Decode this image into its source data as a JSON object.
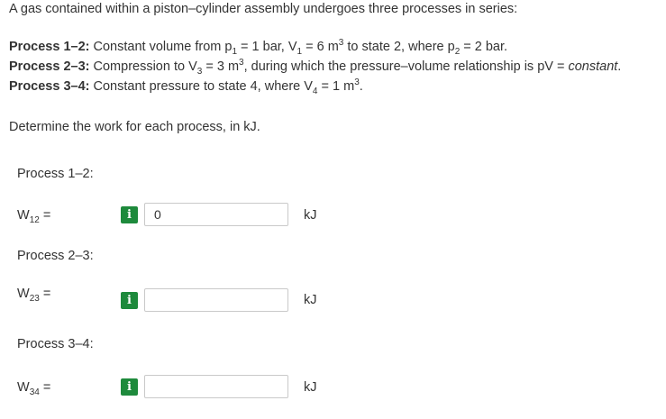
{
  "problem": {
    "intro": "A gas contained within a piston–cylinder assembly undergoes three processes in series:",
    "p12": {
      "label": "Process 1–2:",
      "text_a": " Constant volume from p",
      "sub_1": "1",
      "text_b": " = 1 bar, V",
      "sub_2": "1",
      "text_c": " = 6 m",
      "sup_1": "3",
      "text_d": " to state 2, where p",
      "sub_3": "2",
      "text_e": " = 2 bar."
    },
    "p23": {
      "label": "Process 2–3:",
      "text_a": " Compression to V",
      "sub_1": "3",
      "text_b": " = 3 m",
      "sup_1": "3",
      "text_c": ", during which the pressure–volume relationship is pV = ",
      "italic": "constant",
      "text_d": "."
    },
    "p34": {
      "label": "Process 3–4:",
      "text_a": " Constant pressure to state 4, where V",
      "sub_1": "4",
      "text_b": " = 1 m",
      "sup_1": "3",
      "text_c": "."
    },
    "question": "Determine the work for each process, in kJ."
  },
  "answers": [
    {
      "section_title": "Process 1–2:",
      "var_main": "W",
      "var_sub": "12",
      "equals": " =",
      "info_glyph": "i",
      "value": "0",
      "unit": "kJ"
    },
    {
      "section_title": "Process 2–3:",
      "var_main": "W",
      "var_sub": "23",
      "equals": " =",
      "info_glyph": "i",
      "value": "",
      "unit": "kJ"
    },
    {
      "section_title": "Process 3–4:",
      "var_main": "W",
      "var_sub": "34",
      "equals": " =",
      "info_glyph": "i",
      "value": "",
      "unit": "kJ"
    }
  ],
  "colors": {
    "info_button": "#1e8a3c",
    "text": "#333333",
    "input_border": "#c9c9c9"
  },
  "icons": {
    "info": "info-icon"
  }
}
